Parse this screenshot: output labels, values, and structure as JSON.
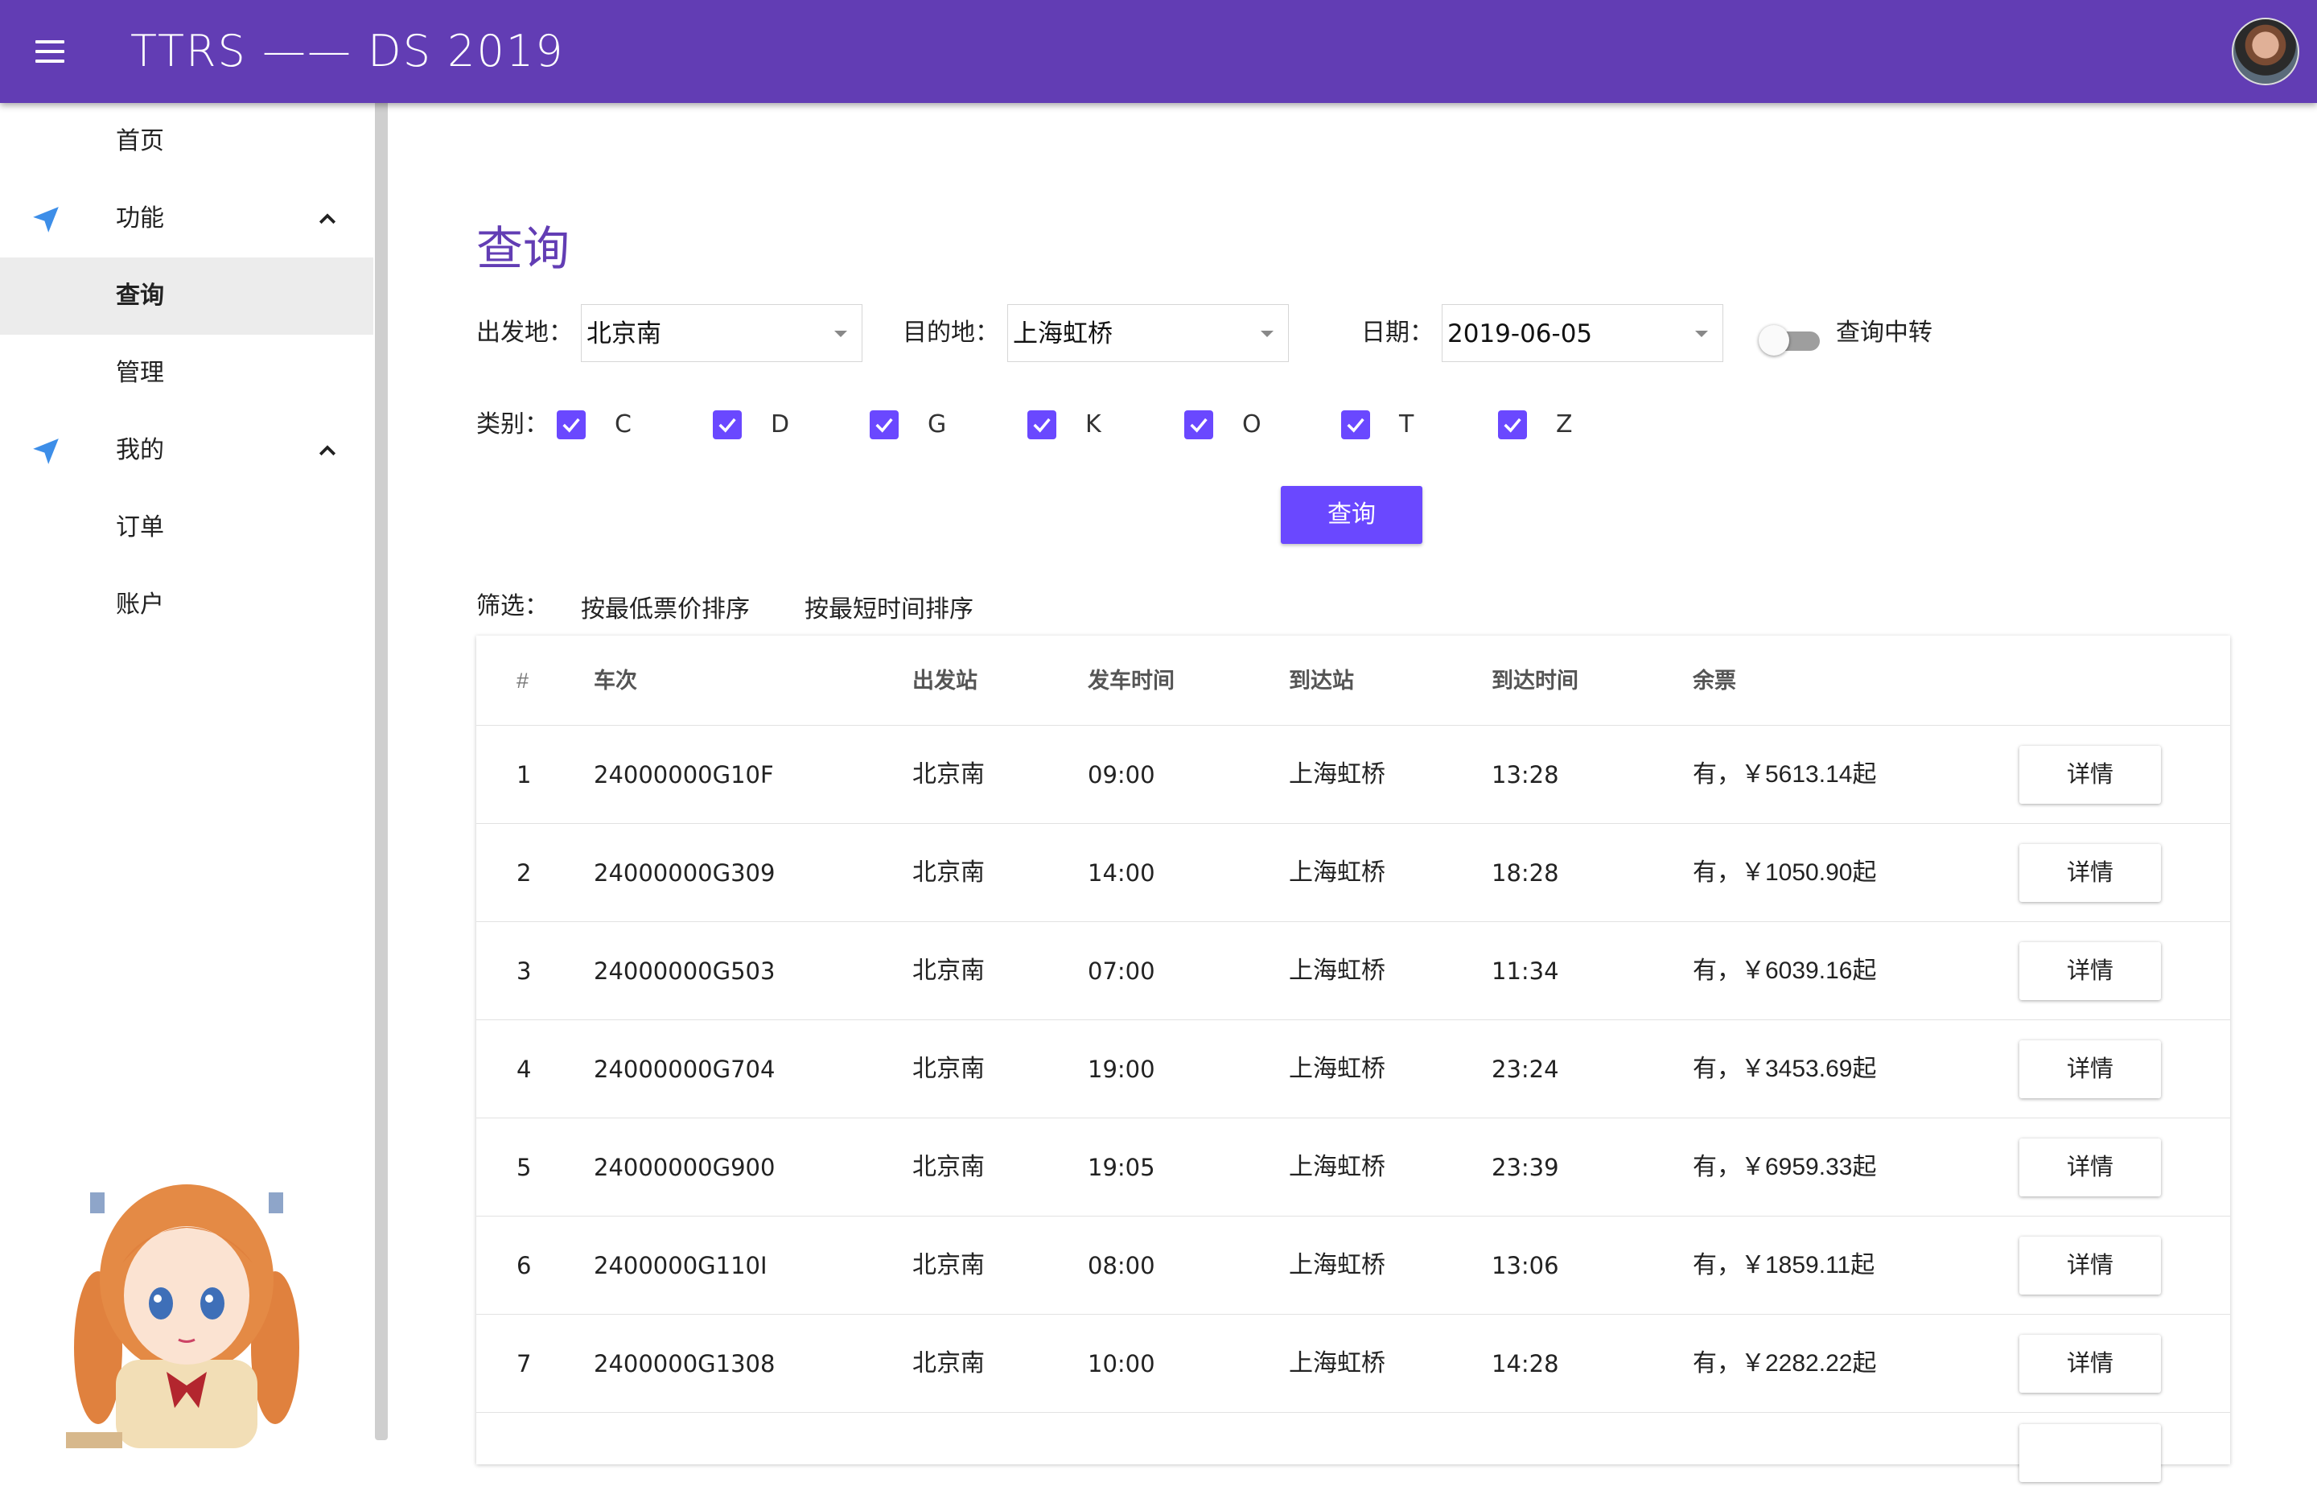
{
  "app": {
    "title": "TTRS —— DS 2019",
    "accent_color": "#623db4",
    "primary_button_color": "#6a48ff"
  },
  "sidebar": {
    "items": [
      {
        "label": "首页",
        "icon": null
      },
      {
        "label": "功能",
        "icon": "navigation-arrow-icon",
        "expanded": true
      },
      {
        "label": "查询",
        "active": true
      },
      {
        "label": "管理"
      },
      {
        "label": "我的",
        "icon": "navigation-arrow-icon",
        "expanded": true
      },
      {
        "label": "订单"
      },
      {
        "label": "账户"
      }
    ]
  },
  "search": {
    "title": "查询",
    "from_label": "出发地：",
    "from_value": "北京南",
    "to_label": "目的地：",
    "to_value": "上海虹桥",
    "date_label": "日期：",
    "date_value": "2019-06-05",
    "transfer_label": "查询中转",
    "transfer_on": false,
    "category_label": "类别：",
    "categories": [
      {
        "label": "C",
        "checked": true
      },
      {
        "label": "D",
        "checked": true
      },
      {
        "label": "G",
        "checked": true
      },
      {
        "label": "K",
        "checked": true
      },
      {
        "label": "O",
        "checked": true
      },
      {
        "label": "T",
        "checked": true
      },
      {
        "label": "Z",
        "checked": true
      }
    ],
    "submit_label": "查询"
  },
  "filter": {
    "label": "筛选：",
    "sort_price": "按最低票价排序",
    "sort_time": "按最短时间排序"
  },
  "table": {
    "headers": [
      "#",
      "车次",
      "出发站",
      "发车时间",
      "到达站",
      "到达时间",
      "余票"
    ],
    "detail_label": "详情",
    "rows": [
      {
        "idx": "1",
        "train": "24000000G10F",
        "from": "北京南",
        "depart": "09:00",
        "to": "上海虹桥",
        "arrive": "13:28",
        "tickets": "有，￥5613.14起"
      },
      {
        "idx": "2",
        "train": "24000000G309",
        "from": "北京南",
        "depart": "14:00",
        "to": "上海虹桥",
        "arrive": "18:28",
        "tickets": "有，￥1050.90起"
      },
      {
        "idx": "3",
        "train": "24000000G503",
        "from": "北京南",
        "depart": "07:00",
        "to": "上海虹桥",
        "arrive": "11:34",
        "tickets": "有，￥6039.16起"
      },
      {
        "idx": "4",
        "train": "24000000G704",
        "from": "北京南",
        "depart": "19:00",
        "to": "上海虹桥",
        "arrive": "23:24",
        "tickets": "有，￥3453.69起"
      },
      {
        "idx": "5",
        "train": "24000000G900",
        "from": "北京南",
        "depart": "19:05",
        "to": "上海虹桥",
        "arrive": "23:39",
        "tickets": "有，￥6959.33起"
      },
      {
        "idx": "6",
        "train": "2400000G110I",
        "from": "北京南",
        "depart": "08:00",
        "to": "上海虹桥",
        "arrive": "13:06",
        "tickets": "有，￥1859.11起"
      },
      {
        "idx": "7",
        "train": "2400000G1308",
        "from": "北京南",
        "depart": "10:00",
        "to": "上海虹桥",
        "arrive": "14:28",
        "tickets": "有，￥2282.22起"
      }
    ]
  }
}
